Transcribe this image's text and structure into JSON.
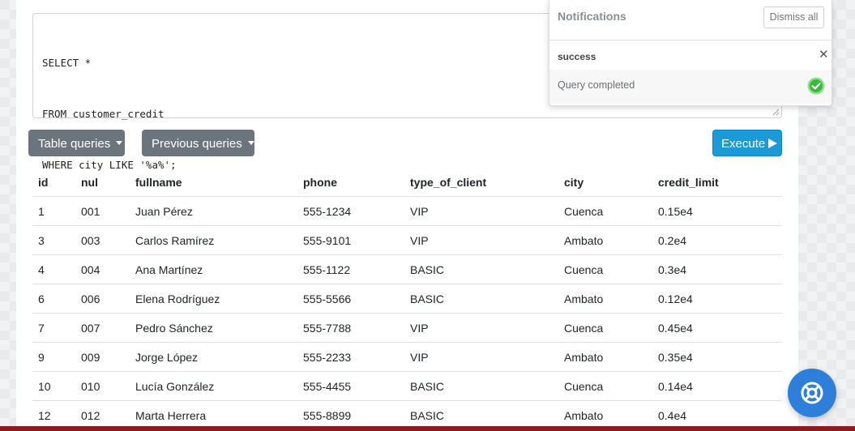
{
  "editor": {
    "lines": [
      "SELECT *",
      "FROM customer_credit",
      "WHERE city LIKE '%a%';"
    ]
  },
  "toolbar": {
    "table_queries_label": "Table queries",
    "previous_queries_label": "Previous queries",
    "execute_label": "Execute"
  },
  "results": {
    "columns": [
      "id",
      "nul",
      "fullname",
      "phone",
      "type_of_client",
      "city",
      "credit_limit"
    ],
    "rows": [
      [
        "1",
        "001",
        "Juan Pérez",
        "555-1234",
        "VIP",
        "Cuenca",
        "0.15e4"
      ],
      [
        "3",
        "003",
        "Carlos Ramírez",
        "555-9101",
        "VIP",
        "Ambato",
        "0.2e4"
      ],
      [
        "4",
        "004",
        "Ana Martínez",
        "555-1122",
        "BASIC",
        "Cuenca",
        "0.3e4"
      ],
      [
        "6",
        "006",
        "Elena Rodríguez",
        "555-5566",
        "BASIC",
        "Ambato",
        "0.12e4"
      ],
      [
        "7",
        "007",
        "Pedro Sánchez",
        "555-7788",
        "VIP",
        "Cuenca",
        "0.45e4"
      ],
      [
        "9",
        "009",
        "Jorge López",
        "555-2233",
        "VIP",
        "Ambato",
        "0.35e4"
      ],
      [
        "10",
        "010",
        "Lucía González",
        "555-4455",
        "BASIC",
        "Cuenca",
        "0.14e4"
      ],
      [
        "12",
        "012",
        "Marta Herrera",
        "555-8899",
        "BASIC",
        "Ambato",
        "0.4e4"
      ]
    ]
  },
  "notifications": {
    "title": "Notifications",
    "dismiss_all_label": "Dismiss all",
    "items": [
      {
        "kind": "success",
        "message": "Query completed",
        "icon": "check-circle-icon"
      }
    ]
  },
  "colors": {
    "execute": "#1a9bd7",
    "secondary": "#6c757d",
    "help": "#2e7fd9",
    "bottom_bar": "#8e1b1b",
    "success_check": "#3cb83c"
  }
}
